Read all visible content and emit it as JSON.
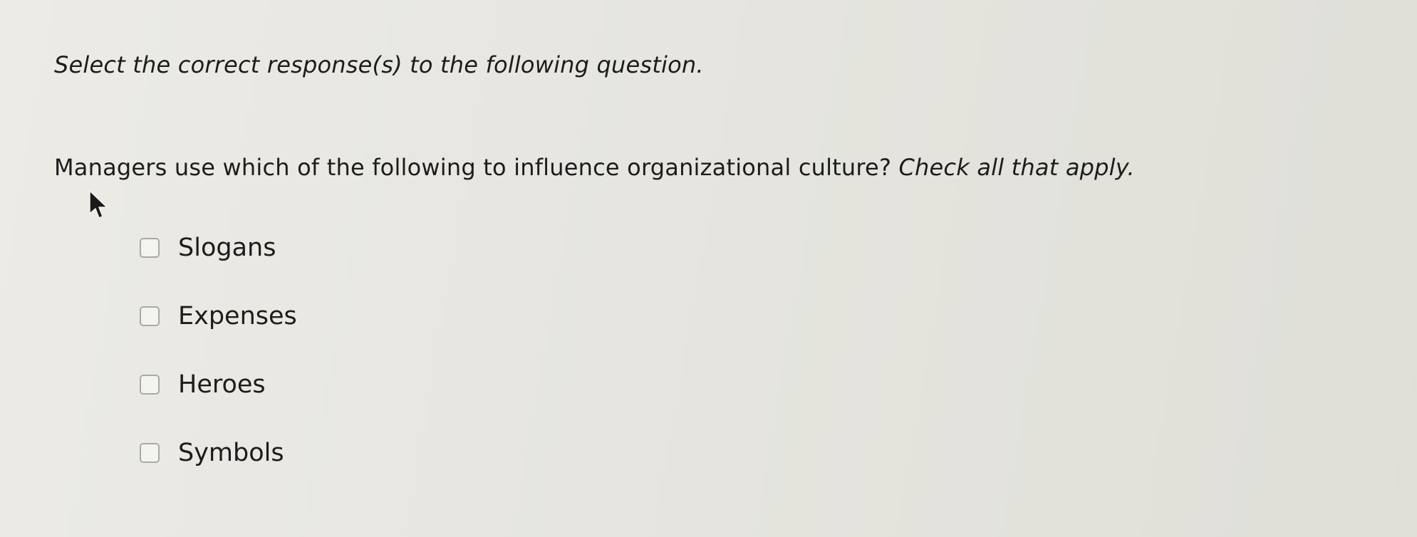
{
  "instruction": "Select the correct response(s) to the following question.",
  "question": {
    "text": "Managers use which of the following to influence organizational culture?",
    "emphasis": "Check all that apply."
  },
  "options": [
    {
      "label": "Slogans",
      "checked": false
    },
    {
      "label": "Expenses",
      "checked": false
    },
    {
      "label": "Heroes",
      "checked": false
    },
    {
      "label": "Symbols",
      "checked": false
    }
  ]
}
